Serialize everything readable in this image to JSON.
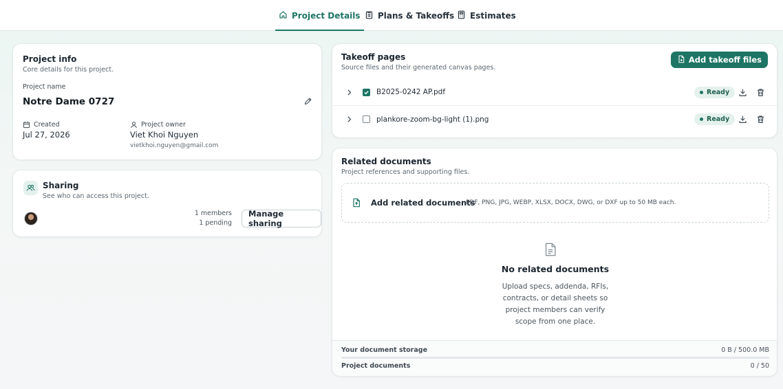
{
  "nav": {
    "tabs": [
      {
        "label": "Project Details",
        "icon": "home-icon",
        "active": true
      },
      {
        "label": "Plans & Takeoffs",
        "icon": "clipboard-icon",
        "active": false
      },
      {
        "label": "Estimates",
        "icon": "calculator-icon",
        "active": false
      }
    ]
  },
  "project_info": {
    "title": "Project info",
    "subtitle": "Core details for this project.",
    "name_label": "Project name",
    "name": "Notre Dame 0727",
    "created_label": "Created",
    "created": "Jul 27, 2026",
    "owner_label": "Project owner",
    "owner_name": "Viet Khoi Nguyen",
    "owner_email": "vietkhoi.nguyen@gmail.com"
  },
  "sharing": {
    "title": "Sharing",
    "subtitle": "See who can access this project.",
    "members": "1 members",
    "pending": "1 pending",
    "manage_label": "Manage sharing"
  },
  "takeoff": {
    "title": "Takeoff pages",
    "subtitle": "Source files and their generated canvas pages.",
    "add_label": "Add takeoff files",
    "files": [
      {
        "name": "B2025-0242 AP.pdf",
        "checked": true,
        "status": "Ready"
      },
      {
        "name": "plankore-zoom-bg-light (1).png",
        "checked": false,
        "status": "Ready"
      }
    ]
  },
  "related": {
    "title": "Related documents",
    "subtitle": "Project references and supporting files.",
    "add_label": "Add related documents",
    "add_hint": "PDF, PNG, JPG, WEBP, XLSX, DOCX, DWG, or DXF up to 50 MB each.",
    "empty_title": "No related documents",
    "empty_lines": [
      "Upload specs, addenda, RFIs,",
      "contracts, or detail sheets so",
      "project members can verify",
      "scope from one place."
    ],
    "storage_label": "Your document storage",
    "storage_value": "0 B / 500.0 MB",
    "storage_fraction": 0,
    "docs_label": "Project documents",
    "docs_value": "0 / 50"
  },
  "colors": {
    "accent": "#1e7565",
    "badge_bg": "#e4f1ec"
  }
}
